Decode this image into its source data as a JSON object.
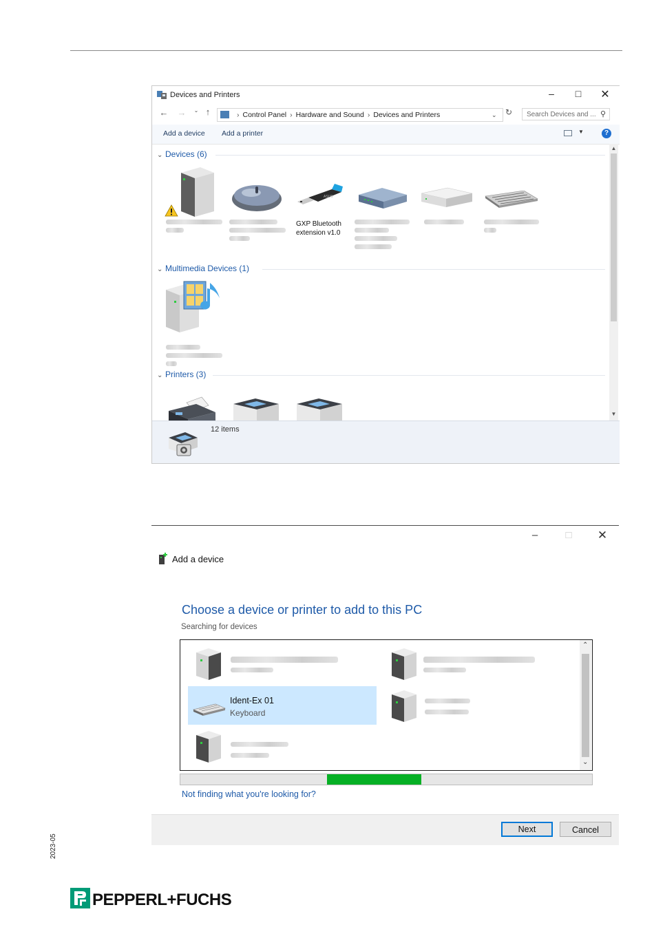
{
  "page": {
    "side_year": "2023-05",
    "brand": "PEPPERL+FUCHS"
  },
  "devices_window": {
    "title": "Devices and Printers",
    "breadcrumbs": [
      "Control Panel",
      "Hardware and Sound",
      "Devices and Printers"
    ],
    "search_placeholder": "Search Devices and ...",
    "commands": {
      "add_device": "Add a device",
      "add_printer": "Add a printer"
    },
    "help_icon": "?",
    "groups": {
      "devices": "Devices (6)",
      "multimedia": "Multimedia Devices (1)",
      "printers": "Printers (3)"
    },
    "bluetooth_label_line1": "GXP Bluetooth",
    "bluetooth_label_line2": "extension v1.0",
    "status_count": "12 items"
  },
  "add_device_window": {
    "title": "Add a device",
    "heading": "Choose a device or printer to add to this PC",
    "status": "Searching for devices",
    "selected_device": {
      "name": "Ident-Ex 01",
      "type": "Keyboard"
    },
    "progress": 0.47,
    "help_link": "Not finding what you're looking for?",
    "buttons": {
      "next": "Next",
      "cancel": "Cancel"
    }
  },
  "colors": {
    "accent_blue": "#1e5aa8",
    "progress_green": "#06b025",
    "selection": "#cce8ff"
  }
}
